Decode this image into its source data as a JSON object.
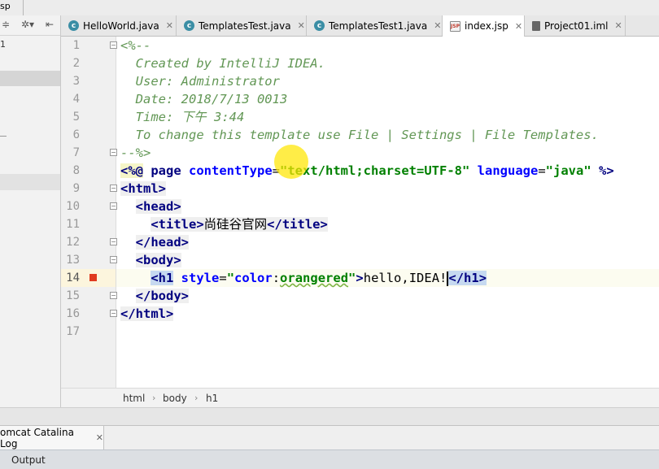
{
  "top_strip": {
    "file_fragment": "sp"
  },
  "left_panel": {
    "tool_icons": [
      "split-icon",
      "gear-icon",
      "collapse-icon"
    ],
    "number_fragment": "1"
  },
  "tabs": [
    {
      "label": "HelloWorld.java",
      "icon": "java-class-icon",
      "active": false
    },
    {
      "label": "TemplatesTest.java",
      "icon": "java-class-icon",
      "active": false
    },
    {
      "label": "TemplatesTest1.java",
      "icon": "java-class-icon",
      "active": false
    },
    {
      "label": "index.jsp",
      "icon": "jsp-file-icon",
      "active": true
    },
    {
      "label": "Project01.iml",
      "icon": "iml-file-icon",
      "active": false
    }
  ],
  "editor": {
    "current_line": 14,
    "breakpoint_line": 14,
    "line_numbers": [
      "1",
      "2",
      "3",
      "4",
      "5",
      "6",
      "7",
      "8",
      "9",
      "10",
      "11",
      "12",
      "13",
      "14",
      "15",
      "16",
      "17"
    ],
    "comment": {
      "open": "<%--",
      "created": "Created by IntelliJ IDEA.",
      "user": "User: Administrator",
      "date": "Date: 2018/7/13 0013",
      "time": "Time: 下午 3:44",
      "change": "To change this template use File | Settings | File Templates.",
      "close": "--%>"
    },
    "directive": {
      "open": "<%@",
      "page": "page",
      "ct_attr": "contentType",
      "eq1": "=",
      "ct_val": "\"text/html;charset=UTF-8\"",
      "lang_attr": "language",
      "eq2": "=",
      "lang_val": "\"java\"",
      "close": "%>"
    },
    "tags": {
      "html_open": "<html>",
      "head_open": "<head>",
      "title_open": "<title>",
      "title_text": "尚硅谷官网",
      "title_close": "</title>",
      "head_close": "</head>",
      "body_open": "<body>",
      "h1_open": "<h1",
      "style_attr": "style",
      "style_eq": "=",
      "style_q1": "\"",
      "css_prop": "color",
      "css_colon": ":",
      "css_val": "orangered",
      "style_q2": "\"",
      "h1_gt": ">",
      "h1_text": "hello,IDEA!",
      "h1_close": "</h1>",
      "body_close": "</body>",
      "html_close": "</html>"
    }
  },
  "breadcrumb": [
    "html",
    "body",
    "h1"
  ],
  "bottom_tab": {
    "label": "omcat Catalina Log"
  },
  "output_label": "Output"
}
